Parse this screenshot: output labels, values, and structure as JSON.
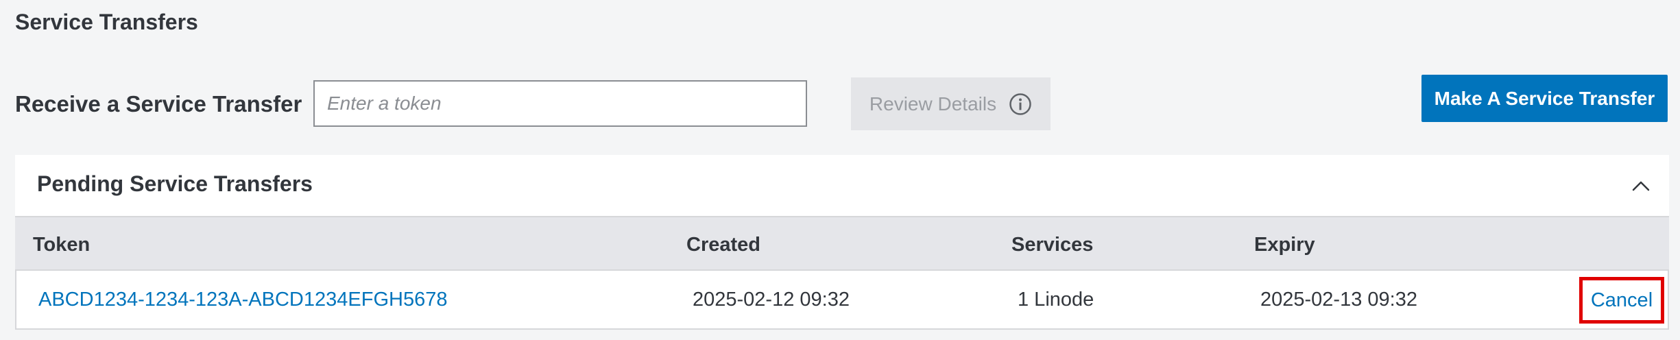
{
  "page": {
    "title": "Service Transfers"
  },
  "receive": {
    "label": "Receive a Service Transfer",
    "token_placeholder": "Enter a token",
    "token_value": "",
    "review_button": "Review Details",
    "make_button": "Make A Service Transfer"
  },
  "pending": {
    "title": "Pending Service Transfers",
    "columns": {
      "token": "Token",
      "created": "Created",
      "services": "Services",
      "expiry": "Expiry"
    },
    "rows": [
      {
        "token": "ABCD1234-1234-123A-ABCD1234EFGH5678",
        "created": "2025-02-12 09:32",
        "services": "1 Linode",
        "expiry": "2025-02-13 09:32",
        "action": "Cancel"
      }
    ]
  },
  "icons": {
    "info": "info-icon",
    "collapse": "chevron-up-icon"
  },
  "colors": {
    "background": "#f4f5f6",
    "primary": "#0174bc",
    "disabled_bg": "#e4e5e8",
    "table_header_bg": "#e5e6ea",
    "highlight": "#e00000"
  }
}
